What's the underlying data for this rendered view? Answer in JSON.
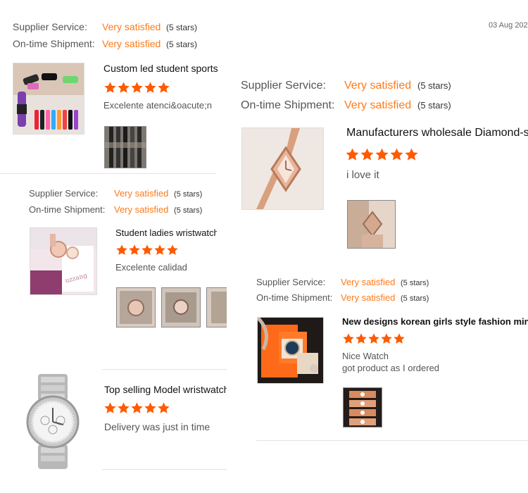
{
  "colors": {
    "accent": "#ff7a1a",
    "star": "#ff5a00"
  },
  "reviews": [
    {
      "date": "03 Aug 202",
      "supplier_label": "Supplier Service:",
      "supplier_value": "Very satisfied",
      "supplier_count": "(5 stars)",
      "shipment_label": "On-time Shipment:",
      "shipment_value": "Very satisfied",
      "shipment_count": "(5 stars)",
      "product_title": "Custom led student sports",
      "rating": 5,
      "comment": "Excelente atenci&oacute;n"
    },
    {
      "supplier_label": "Supplier Service:",
      "supplier_value": "Very satisfied",
      "supplier_count": "(5 stars)",
      "shipment_label": "On-time Shipment:",
      "shipment_value": "Very satisfied",
      "shipment_count": "(5 stars)",
      "product_title": "Student ladies wristwatch",
      "rating": 5,
      "comment": "Excelente calidad"
    },
    {
      "product_title": "Top selling Model wristwatch",
      "rating": 5,
      "comment": "Delivery was just in time"
    },
    {
      "supplier_label": "Supplier Service:",
      "supplier_value": "Very satisfied",
      "supplier_count": "(5 stars)",
      "shipment_label": "On-time Shipment:",
      "shipment_value": "Very satisfied",
      "shipment_count": "(5 stars)",
      "product_title": "Manufacturers wholesale Diamond-s",
      "rating": 5,
      "comment": "i love it"
    },
    {
      "supplier_label": "Supplier Service:",
      "supplier_value": "Very satisfied",
      "supplier_count": "(5 stars)",
      "shipment_label": "On-time Shipment:",
      "shipment_value": "Very satisfied",
      "shipment_count": "(5 stars)",
      "product_title": "New designs korean girls style fashion minima",
      "rating": 5,
      "comment_line1": "Nice Watch",
      "comment_line2": "got product as I ordered"
    }
  ]
}
